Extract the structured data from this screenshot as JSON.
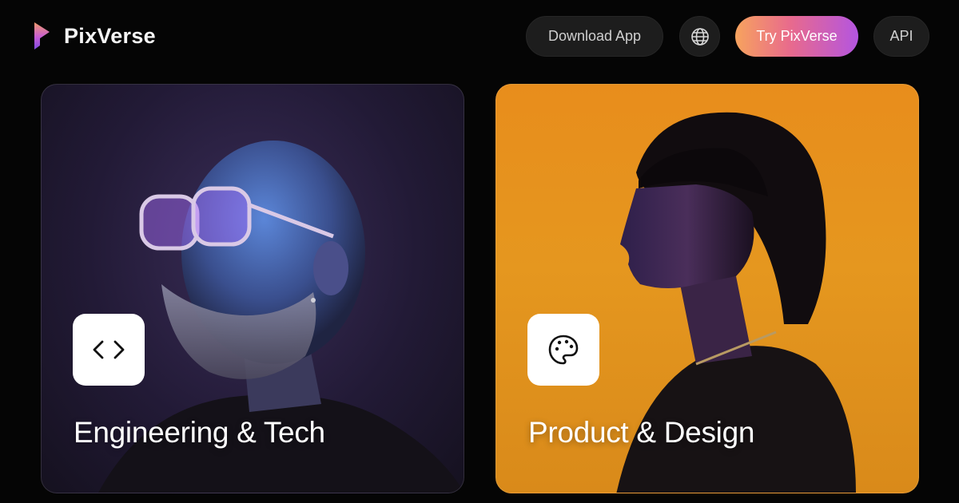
{
  "brand": {
    "name": "PixVerse",
    "icon": "pixverse-logo-icon"
  },
  "nav": {
    "download_label": "Download App",
    "language_icon": "globe-icon",
    "try_label": "Try PixVerse",
    "api_label": "API"
  },
  "cards": [
    {
      "label": "Engineering & Tech",
      "icon": "code-icon"
    },
    {
      "label": "Product & Design",
      "icon": "palette-icon"
    }
  ],
  "colors": {
    "background": "#050505",
    "try_gradient": [
      "#f7a35e",
      "#e86a8d",
      "#b455e0"
    ],
    "engineering_card": "#2a2140",
    "product_card": "#e5971f"
  }
}
